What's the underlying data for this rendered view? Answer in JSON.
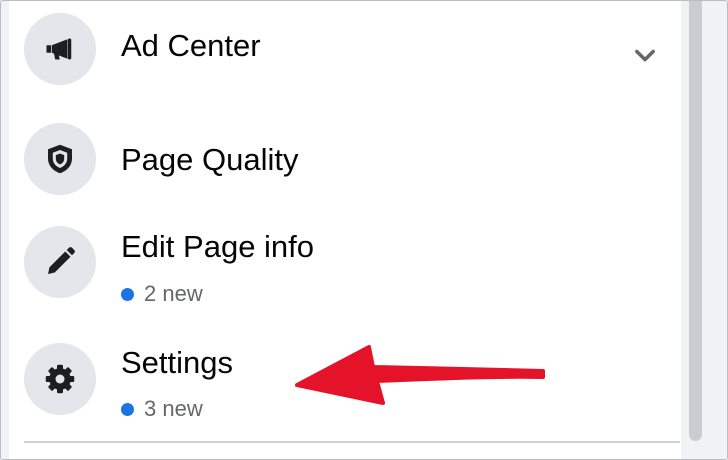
{
  "menu": {
    "items": [
      {
        "label": "Ad Center",
        "icon": "megaphone-icon",
        "expandable": true
      },
      {
        "label": "Page Quality",
        "icon": "shield-icon"
      },
      {
        "label": "Edit Page info",
        "icon": "pencil-icon",
        "badge": "2 new"
      },
      {
        "label": "Settings",
        "icon": "gear-icon",
        "badge": "3 new"
      }
    ]
  },
  "colors": {
    "badge_dot": "#1b74e4",
    "annotation_arrow": "#e5132a",
    "icon_circle": "#e4e6eb",
    "text": "#050505"
  },
  "annotation": {
    "type": "arrow",
    "points_to": "Settings"
  }
}
